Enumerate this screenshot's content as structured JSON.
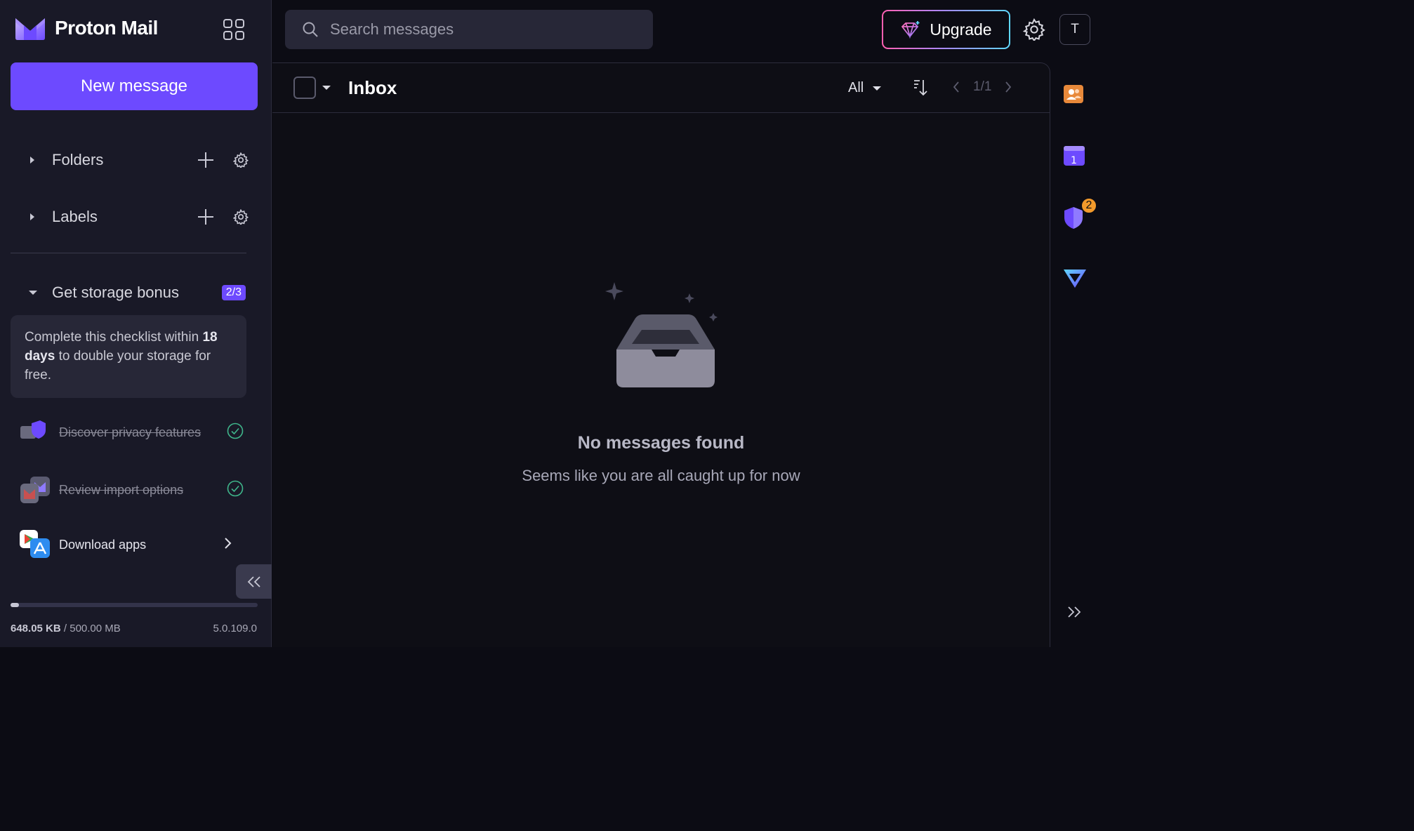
{
  "brand": {
    "name": "Proton Mail"
  },
  "sidebar": {
    "new_message": "New message",
    "folders_label": "Folders",
    "labels_label": "Labels",
    "bonus": {
      "title": "Get storage bonus",
      "progress": "2/3",
      "card_pre": "Complete this checklist within ",
      "card_bold": "18 days",
      "card_post": " to double your storage for free."
    },
    "checklist": [
      {
        "label": "Discover privacy features",
        "done": true
      },
      {
        "label": "Review import options",
        "done": true
      },
      {
        "label": "Download apps",
        "done": false
      }
    ],
    "storage": {
      "used": "648.05 KB",
      "separator": " / ",
      "total": "500.00 MB",
      "fraction": 0.0013
    },
    "version": "5.0.109.0"
  },
  "topbar": {
    "search_placeholder": "Search messages",
    "upgrade_label": "Upgrade",
    "avatar_initial": "T"
  },
  "main": {
    "title": "Inbox",
    "filter": "All",
    "pagination": "1/1",
    "empty_title": "No messages found",
    "empty_subtitle": "Seems like you are all caught up for now"
  },
  "rail": {
    "security_badge": "2",
    "calendar_day": "1"
  },
  "colors": {
    "accent": "#6d4aff",
    "sidebar_bg": "#191927",
    "main_bg": "#0e0e15",
    "badge": "#f39a2b",
    "success": "#3fb68b"
  },
  "icons": [
    "apps-grid-icon",
    "caret-right-icon",
    "plus-icon",
    "gear-icon",
    "caret-down-icon",
    "check-circle-icon",
    "chevron-right-icon",
    "double-chevron-left-icon",
    "search-icon",
    "diamond-icon",
    "sort-icon",
    "chevron-left-icon",
    "inbox-icon",
    "contacts-icon",
    "calendar-icon",
    "shield-icon",
    "vpn-icon",
    "double-chevron-right-icon"
  ]
}
